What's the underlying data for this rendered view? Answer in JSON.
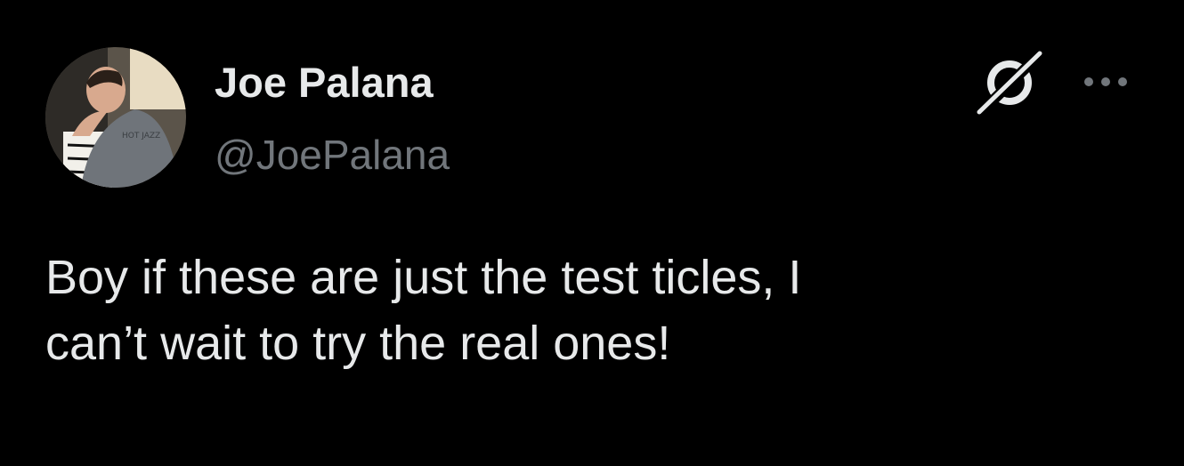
{
  "tweet": {
    "author": {
      "display_name": "Joe Palana",
      "handle": "@JoePalana",
      "avatar_icon": "user-avatar-photo",
      "shirt_text": "HOT JAZZ"
    },
    "actions": {
      "grok_icon": "grok-icon",
      "more_icon": "more-options-icon"
    },
    "text_lines": [
      "Boy if these are just the test ticles, I",
      "can’t wait to try the real ones!"
    ]
  },
  "colors": {
    "background": "#000000",
    "primary_text": "#e7e9ea",
    "secondary_text": "#71767b"
  }
}
